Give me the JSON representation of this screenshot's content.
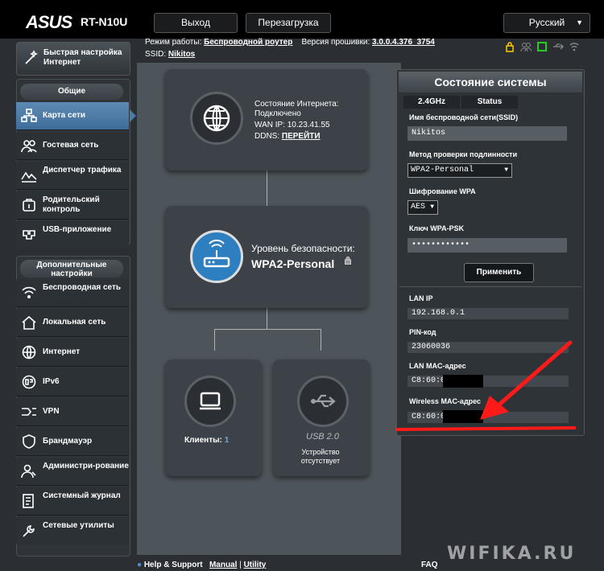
{
  "header": {
    "logo": "ASUS",
    "model": "RT-N10U",
    "logout_label": "Выход",
    "reboot_label": "Перезагрузка",
    "language": "Русский"
  },
  "info": {
    "mode_label": "Режим работы:",
    "mode_value": "Беспроводной роутер",
    "firmware_label": "Версия прошивки:",
    "firmware_value": "3.0.0.4.376_3754",
    "ssid_label": "SSID:",
    "ssid_value": "Nikitos"
  },
  "sidebar": {
    "quick_setup": "Быстрая настройка Интернет",
    "general_header": "Общие",
    "general_items": [
      {
        "label": "Карта сети",
        "icon": "network-map-icon"
      },
      {
        "label": "Гостевая сеть",
        "icon": "guest-network-icon"
      },
      {
        "label": "Диспетчер трафика",
        "icon": "traffic-manager-icon"
      },
      {
        "label": "Родительский контроль",
        "icon": "parental-control-icon"
      },
      {
        "label": "USB-приложение",
        "icon": "usb-app-icon"
      }
    ],
    "advanced_header": "Дополнительные настройки",
    "advanced_items": [
      {
        "label": "Беспроводная сеть",
        "icon": "wireless-icon"
      },
      {
        "label": "Локальная сеть",
        "icon": "lan-icon"
      },
      {
        "label": "Интернет",
        "icon": "internet-icon"
      },
      {
        "label": "IPv6",
        "icon": "ipv6-icon"
      },
      {
        "label": "VPN",
        "icon": "vpn-icon"
      },
      {
        "label": "Брандмауэр",
        "icon": "firewall-icon"
      },
      {
        "label": "Администри-рование",
        "icon": "administration-icon"
      },
      {
        "label": "Системный журнал",
        "icon": "system-log-icon"
      },
      {
        "label": "Сетевые утилиты",
        "icon": "network-tools-icon"
      }
    ]
  },
  "map": {
    "internet_status_label": "Состояние Интернета:",
    "internet_status_value": "Подключено",
    "wan_ip_label": "WAN IP:",
    "wan_ip_value": "10.23.41.55",
    "ddns_label": "DDNS:",
    "ddns_link": "ПЕРЕЙТИ",
    "security_label": "Уровень безопасности:",
    "security_value": "WPA2-Personal",
    "clients_label": "Клиенты:",
    "clients_count": "1",
    "usb_label": "USB 2.0",
    "usb_status": "Устройство отсутствует"
  },
  "status": {
    "title": "Состояние системы",
    "tab_band": "2.4GHz",
    "tab_status": "Status",
    "ssid_label": "Имя беспроводной сети(SSID)",
    "ssid_value": "Nikitos",
    "auth_label": "Метод проверки подлинности",
    "auth_value": "WPA2-Personal",
    "enc_label": "Шифрование WPA",
    "enc_value": "AES",
    "psk_label": "Ключ WPA-PSK",
    "psk_value": "••••••••••••",
    "apply_label": "Применить",
    "lan_ip_label": "LAN IP",
    "lan_ip_value": "192.168.0.1",
    "pin_label": "PIN-код",
    "pin_value": "23060036",
    "lan_mac_label": "LAN MAC-адрес",
    "lan_mac_value": "C8:60:0",
    "wl_mac_label": "Wireless MAC-адрес",
    "wl_mac_value": "C8:60:0"
  },
  "footer": {
    "help": "Help & Support",
    "manual": "Manual",
    "utility": "Utility",
    "faq": "FAQ"
  },
  "watermark": "WIFIKA.RU",
  "colors": {
    "accent_blue": "#3f6d99",
    "annotation_red": "#ff1a1a"
  }
}
